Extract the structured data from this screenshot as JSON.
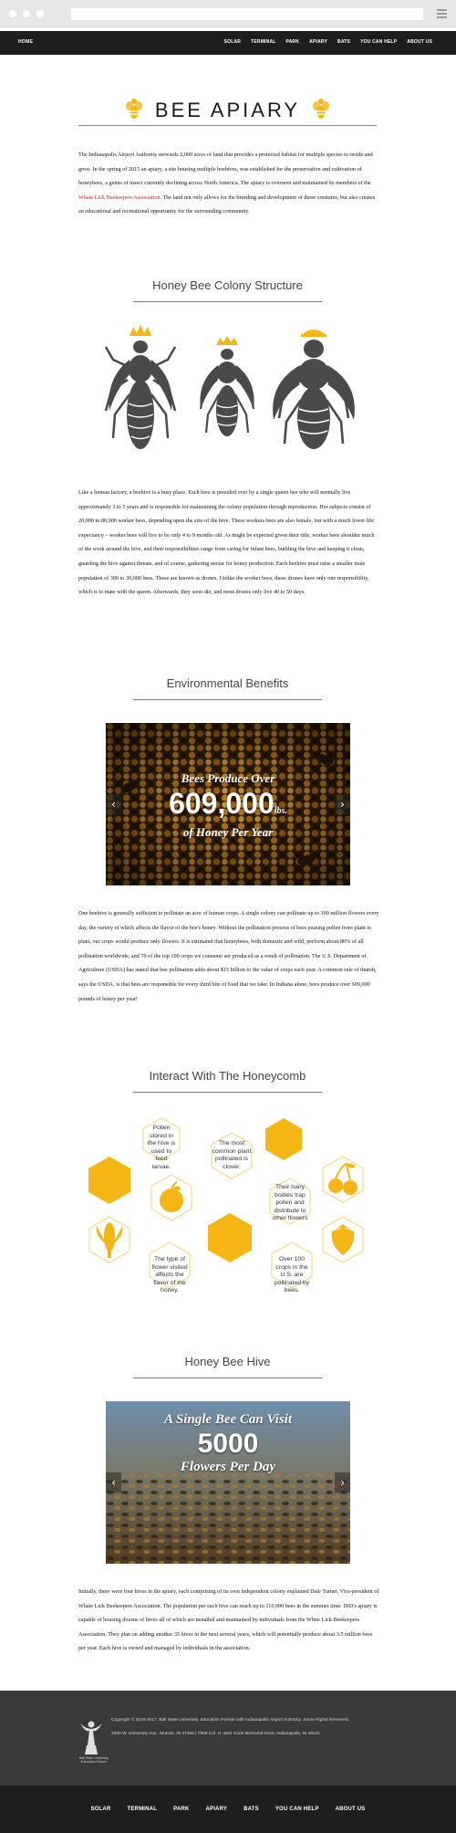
{
  "nav": {
    "home": "HOME",
    "items": [
      "SOLAR",
      "TERMINAL",
      "PARK",
      "APIARY",
      "BATS",
      "YOU CAN HELP",
      "ABOUT US"
    ]
  },
  "page_title": "BEE APIARY",
  "intro": {
    "text_before": "The Indianapolis Airport Authority stewards 2,000 acres of land that provides a protected habitat for multiple species to reside and grow. In the spring of 2015 an apiary, a site housing multiple beehives, was established for the preservation and cultivation of honeybees, a genus of insect currently declining across North America. The apiary is overseen and maintained by members of the ",
    "link": "Whate Lick Beekeepers Association",
    "text_after": ". The land not only allows for the breeding and development of these creatures, but also creates an educational and recreational opportunity for the surrounding community."
  },
  "colony": {
    "heading": "Honey Bee Colony Structure",
    "paragraph": "Like a human factory, a beehive is a busy place. Each hive is presided over by a single queen bee who will normally live approximately 3 to 5 years and is responsible for maintaining the colony population through reproduction. Her subjects consist of 20,000 to 80,000 worker bees, depending upon the size of the hive. These workers bees are also female, but with a much lower life expectancy – worker bees will live to be only 4 to 9 months old. As might be expected given their title, worker bees shoulder much of the work around the hive, and their responsibilities range from caring for infant bees, building the hive and keeping it clean, guarding the hive against threats, and of course, gathering nectar for honey production. Each beehive must raise a smaller male population of 300 to 30,000 bees. These are known as drones. Unlike the worker bees, these drones have only one responsibility, which is to mate with the queen. Afterwards, they soon die, and most drones only live 40 to 50 days."
  },
  "environment": {
    "heading": "Environmental Benefits",
    "slide": {
      "line1": "Bees Produce Over",
      "big": "609,000",
      "unit": "lbs.",
      "line3": "of Honey Per Year"
    },
    "paragraph": "One beehive is generally sufficient to pollinate an acre of human crops. A single colony can pollinate up to 300 million flowers every day, the variety of which affects the flavor of the bee's honey. Without the pollination process of bees passing pollen from plant to plant, our crops would produce only flowers. It is estimated that honeybees, both domestic and wild, perform about 80% of all pollination worldwide, and 70 of the top 100 crops we consume are produced as a result of pollination. The U.S. Department of Agriculture (USDA) has stated that bee pollination adds about $15 billion to the value of crops each year. A common rule of thumb, says the USDA, is that bees are responsible for every third bite of food that we take. In Indiana alone, bees produce over 609,000 pounds of honey per year!"
  },
  "honeycomb": {
    "heading": "Interact With The Honeycomb",
    "facts": [
      "Pollen stored in the hive is used to feed larvae.",
      "The most common plant pollinated is clover.",
      "Their hairy bodies trap pollen and distribute to other flowers",
      "The type of flower visited affects the flavor of the honey.",
      "Over 100 crops in the U.S. are pollinated by bees."
    ],
    "accent": "#f5b515"
  },
  "hive": {
    "heading": "Honey Bee Hive",
    "slide": {
      "line1": "A Single Bee Can Visit",
      "big": "5000",
      "line3": "Flowers Per Day"
    },
    "paragraph": "Initially, there were four hives in the apiary, each comprising of its own independent colony explained Dale Turner, Vice-president of Whate Lick Beekeepers Association. The population per each hive can reach up to 110,000 bees in the summer time. IND's apiary is capable of housing dozens of hives all of which are installed and maintained by individuals from the White Lick Beekeepers Association. They plan on adding another 35 hives in the next several years, which will potentially produce about 3.5 million bees per year. Each hive is owned and managed by individuals in the association."
  },
  "footer": {
    "logo_text": "Ball State University Education Partner",
    "copyright": "Copyright © 2016-2017. Ball State University. Education Partner with Indianapolis Airport Authority. Some Rights Reserved.",
    "address": "2000 W. University Ave., Muncie, IN 47306 | 7800 Col. H. Weir Cook Memorial Drive, Indianapolis, IN 46241"
  },
  "colors": {
    "accent": "#f5b515",
    "dark": "#1e1e1e",
    "link_red": "#c0231b",
    "icon_gray": "#4a4a4a"
  }
}
